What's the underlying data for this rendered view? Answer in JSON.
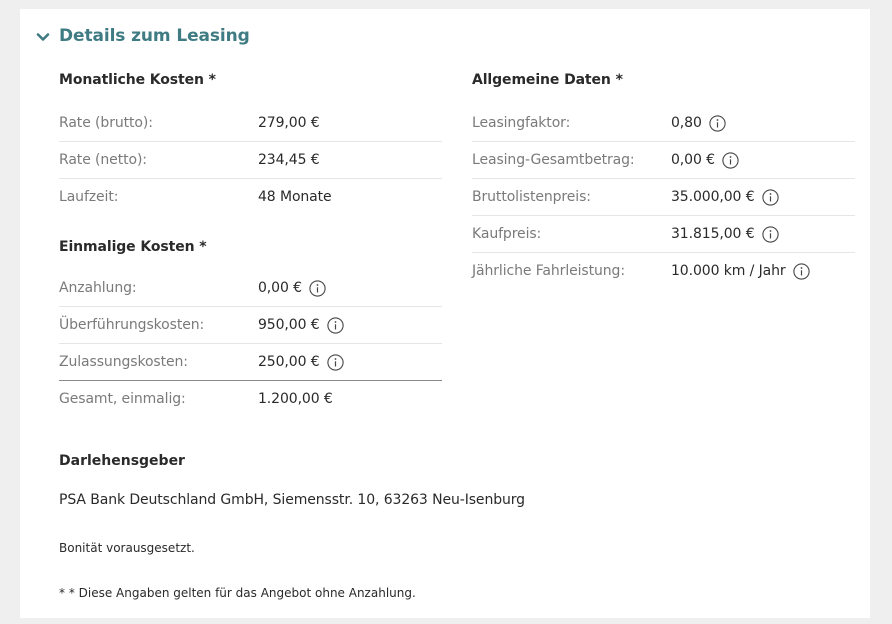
{
  "header": {
    "title": "Details zum Leasing",
    "accent_color": "#3f7b83"
  },
  "monthly": {
    "title": "Monatliche Kosten *",
    "rows": [
      {
        "label": "Rate (brutto):",
        "value": "279,00 €"
      },
      {
        "label": "Rate (netto):",
        "value": "234,45 €"
      },
      {
        "label": "Laufzeit:",
        "value": "48 Monate"
      }
    ]
  },
  "onetime": {
    "title": "Einmalige Kosten *",
    "rows": [
      {
        "label": "Anzahlung:",
        "value": "0,00 €",
        "icon": "info-icon"
      },
      {
        "label": "Überführungskosten:",
        "value": "950,00 €",
        "icon": "info-icon"
      },
      {
        "label": "Zulassungskosten:",
        "value": "250,00 €",
        "icon": "info-icon"
      },
      {
        "label": "Gesamt, einmalig:",
        "value": "1.200,00 €"
      }
    ]
  },
  "general": {
    "title": "Allgemeine Daten *",
    "rows": [
      {
        "label": "Leasingfaktor:",
        "value": "0,80",
        "icon": "info-icon"
      },
      {
        "label": "Leasing-Gesamtbetrag:",
        "value": "0,00 €",
        "icon": "info-icon"
      },
      {
        "label": "Bruttolistenpreis:",
        "value": "35.000,00 €",
        "icon": "info-icon"
      },
      {
        "label": "Kaufpreis:",
        "value": "31.815,00 €",
        "icon": "info-icon"
      },
      {
        "label": "Jährliche Fahrleistung:",
        "value": "10.000 km / Jahr",
        "icon": "info-icon"
      }
    ]
  },
  "lender": {
    "title": "Darlehensgeber",
    "text": "PSA Bank Deutschland GmbH, Siemensstr. 10, 63263 Neu-Isenburg"
  },
  "notes": {
    "credit": "Bonität vorausgesetzt.",
    "footnote": "* * Diese Angaben gelten für das Angebot ohne Anzahlung."
  }
}
